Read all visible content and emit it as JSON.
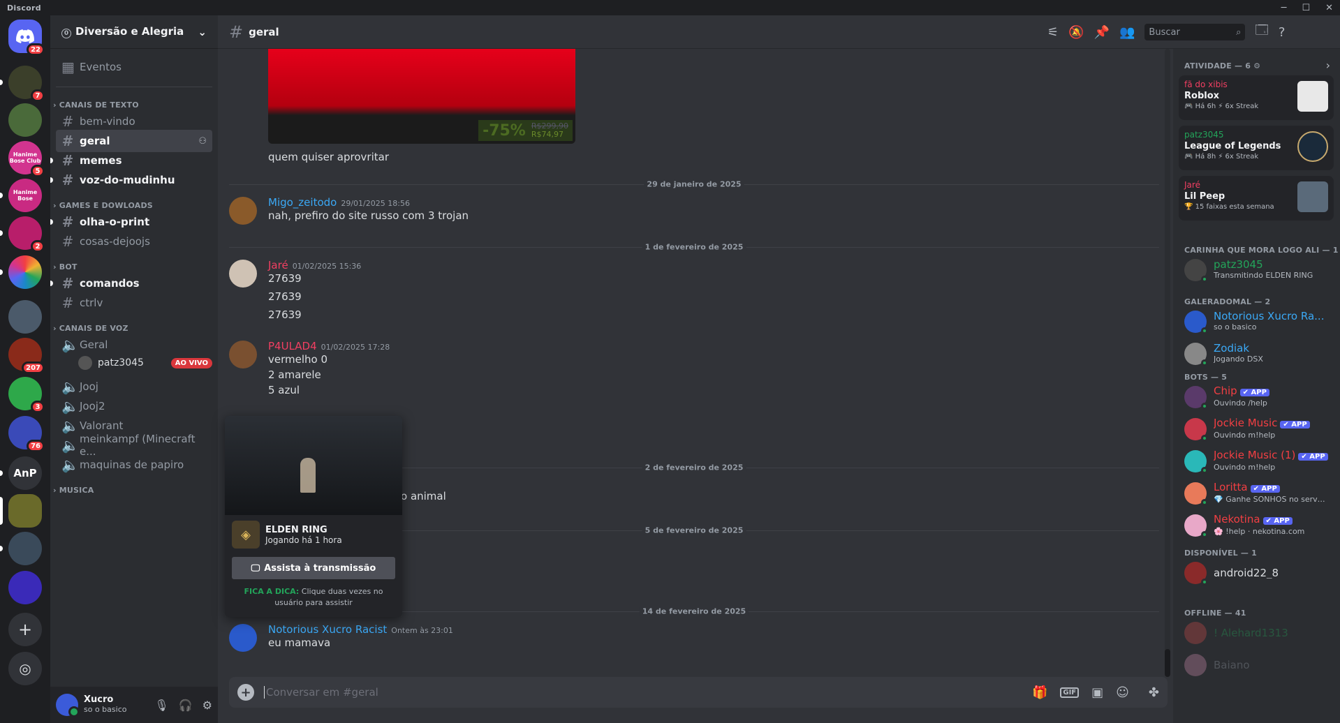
{
  "app": {
    "name": "Discord",
    "controls": [
      "─",
      "☐",
      "✕"
    ]
  },
  "servers": [
    {
      "label": "",
      "badge": "22",
      "color": "#5865f2",
      "icon": "discord-home-icon"
    },
    {
      "label": "",
      "badge": "7",
      "color": "#3b3f2a"
    },
    {
      "label": "",
      "badge": "",
      "color": "#4a6a3a"
    },
    {
      "label": "Hanime Bose Club",
      "badge": "5",
      "color": "#d2348f"
    },
    {
      "label": "Hanime Bose",
      "badge": "",
      "color": "#c92a82"
    },
    {
      "label": "",
      "badge": "2",
      "color": "#b81e6a"
    },
    {
      "label": "",
      "badge": "",
      "color": "#1a88c8"
    },
    {
      "label": "",
      "badge": "",
      "color": "#4b5a6a"
    },
    {
      "label": "",
      "badge": "207",
      "color": "#8a2a1a"
    },
    {
      "label": "",
      "badge": "3",
      "color": "#2ea84a"
    },
    {
      "label": "",
      "badge": "76",
      "color": "#3a4ab8"
    },
    {
      "label": "AnP",
      "badge": "",
      "color": "#313338"
    },
    {
      "label": "",
      "badge": "",
      "color": "#6a6a2a"
    },
    {
      "label": "",
      "badge": "",
      "color": "#3a4a5a"
    },
    {
      "label": "",
      "badge": "",
      "color": "#3a2ab8"
    }
  ],
  "guild": {
    "boost": "0",
    "name": "Diversão e Alegria",
    "events": "Eventos"
  },
  "categories": {
    "text": "CANAIS DE TEXTO",
    "games": "GAMES E DOWLOADS",
    "bot": "BOT",
    "voice": "CANAIS DE VOZ",
    "music": "MUSICA"
  },
  "channels": {
    "bem_vindo": "bem-vindo",
    "geral": "geral",
    "memes": "memes",
    "voz_do_mudinhu": "voz-do-mudinhu",
    "olha_o_print": "olha-o-print",
    "cosas_dejoojs": "cosas-dejoojs",
    "comandos": "comandos",
    "ctrlv": "ctrlv"
  },
  "voice": {
    "geral": "Geral",
    "streamer": "patz3045",
    "live": "AO VIVO",
    "jooj": "Jooj",
    "jooj2": "Jooj2",
    "valorant": "Valorant",
    "meinkampf": "meinkampf (Minecraft e...",
    "maquinas": "maquinas de papiro"
  },
  "user": {
    "name": "Xucro",
    "status": "so o basico"
  },
  "header": {
    "channel": "geral",
    "search_placeholder": "Buscar"
  },
  "embed": {
    "discount": "-75%",
    "old_price": "R$299,90",
    "new_price": "R$74,97"
  },
  "messages": {
    "m0": "quem quiser aprovritar",
    "d1": "29 de janeiro de 2025",
    "m1": {
      "author": "Migo_zeitodo",
      "time": "29/01/2025 18:56",
      "text": "nah, prefiro do site russo com 3 trojan",
      "color": "#3ba9f6"
    },
    "d2": "1 de fevereiro de 2025",
    "m2": {
      "author": "Jaré",
      "time": "01/02/2025 15:36",
      "lines": [
        "27639",
        "27639",
        "27639"
      ],
      "color": "#f23f62"
    },
    "m3": {
      "author": "P4ULAD4",
      "time": "01/02/2025 17:28",
      "lines": [
        "vermelho 0",
        "2 amarele",
        "5 azul"
      ],
      "color": "#f23f62"
    },
    "d3": "2 de fevereiro de 2025",
    "m4_tail": "o animal",
    "d4": "5 de fevereiro de 2025",
    "d5": "14 de fevereiro de 2025",
    "m5": {
      "author": "Notorious Xucro Racist",
      "time": "Ontem às 23:01",
      "text": "eu mamava",
      "color": "#3ba9f6"
    }
  },
  "popout": {
    "game": "ELDEN RING",
    "playing": "Jogando há 1 hora",
    "button": "Assista à transmissão",
    "tip_strong": "FICA A DICA:",
    "tip": "Clique duas vezes no usuário para assistir"
  },
  "composer": {
    "placeholder": "Conversar em #geral"
  },
  "members": {
    "activity_title": "ATIVIDADE — 6",
    "activities": [
      {
        "user": "fã do xibis",
        "game": "Roblox",
        "detail": "🎮 Há 6h  ⚡ 6x Streak",
        "color": "#f23f62"
      },
      {
        "user": "patz3045",
        "game": "League of Legends",
        "detail": "🎮 Há 8h  ⚡ 6x Streak",
        "color": "#23a55a"
      },
      {
        "user": "Jaré",
        "game": "Lil Peep",
        "detail": "🏆 15 faixas esta semana",
        "color": "#f23f62"
      }
    ],
    "sec1": "CARINHA QUE MORA LOGO ALI — 1",
    "carinha": [
      {
        "name": "patz3045",
        "status": "Transmitindo ELDEN RING",
        "color": "#23a55a"
      }
    ],
    "sec2": "GALERADOMAL — 2",
    "galera": [
      {
        "name": "Notorious Xucro Ra...",
        "status": "so o basico",
        "color": "#3ba9f6"
      },
      {
        "name": "Zodiak",
        "status": "Jogando DSX",
        "color": "#3ba9f6"
      }
    ],
    "sec3": "BOTS — 5",
    "app_tag": "✔ APP",
    "bots": [
      {
        "name": "Chip",
        "status": "Ouvindo /help",
        "color": "#f23f43"
      },
      {
        "name": "Jockie Music",
        "status": "Ouvindo m!help",
        "color": "#f23f43"
      },
      {
        "name": "Jockie Music (1)",
        "status": "Ouvindo m!help",
        "color": "#f23f43"
      },
      {
        "name": "Loritta",
        "status": "💎 Ganhe SONHOS no server ...",
        "color": "#f23f43"
      },
      {
        "name": "Nekotina",
        "status": "🌸 !help · nekotina.com",
        "color": "#f23f43"
      }
    ],
    "sec4": "DISPONÍVEL — 1",
    "disponivel": [
      {
        "name": "android22_8",
        "status": "",
        "color": "#dbdee1"
      }
    ],
    "sec5": "OFFLINE — 41",
    "offline": [
      {
        "name": "! Alehard1313",
        "color": "#23a55a"
      },
      {
        "name": "Baiano",
        "color": "#949ba4"
      }
    ]
  }
}
